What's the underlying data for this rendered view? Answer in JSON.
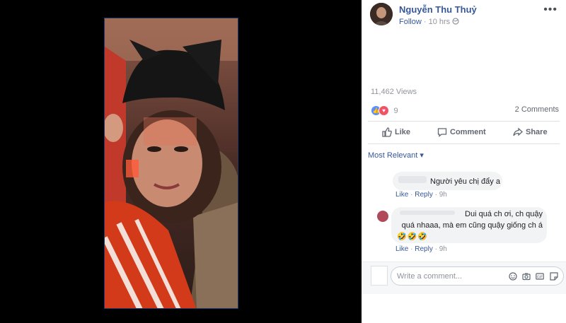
{
  "post": {
    "author_name": "Nguyễn Thu Thuỷ",
    "follow_label": "Follow",
    "separator": "·",
    "time": "10 hrs",
    "more_label": "•••"
  },
  "stats": {
    "views": "11,462 Views",
    "reaction_count": "9",
    "comments_count": "2 Comments"
  },
  "actions": {
    "like": "Like",
    "comment": "Comment",
    "share": "Share"
  },
  "sort": {
    "label": "Most Relevant ▾"
  },
  "comments": [
    {
      "text": "Người yêu chị đẩy a",
      "like_label": "Like",
      "reply_label": "Reply",
      "time": "9h"
    },
    {
      "line1": "Dui quá ch ơi, ch quậy",
      "line2": "quá nhaaa, mà em cũng quậy giống ch á",
      "emoji": "🤣🤣🤣",
      "like_label": "Like",
      "reply_label": "Reply",
      "time": "9h"
    }
  ],
  "composer": {
    "placeholder": "Write a comment..."
  },
  "colors": {
    "link": "#365899",
    "muted": "#90949c",
    "like_reaction": "#5890ff",
    "love_reaction": "#f25268"
  }
}
